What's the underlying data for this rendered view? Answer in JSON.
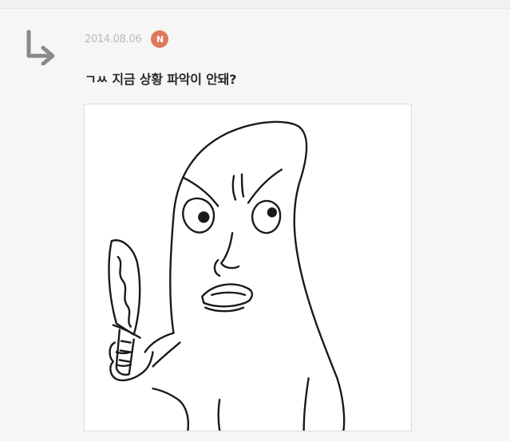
{
  "comment": {
    "reply_icon": "reply-arrow-icon",
    "timestamp": "2014.08.06",
    "new_badge": "N",
    "text": "ㄱㅆ 지금 상황 파악이 안돼?",
    "attachment_icon": "knife-drawing"
  },
  "colors": {
    "page_background": "#f6f6f6",
    "badge": "#e0795a",
    "timestamp": "#b9b9b9",
    "text": "#2a2a2a"
  }
}
